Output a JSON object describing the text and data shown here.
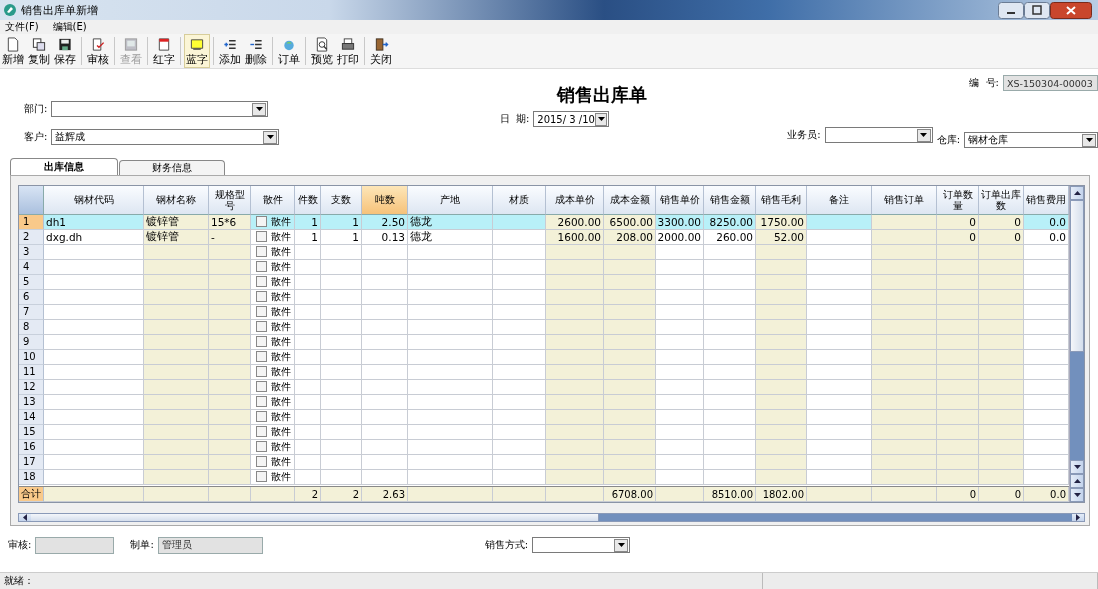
{
  "window": {
    "title": "销售出库单新增"
  },
  "menu": [
    {
      "label": "文件(F)"
    },
    {
      "label": "编辑(E)"
    }
  ],
  "toolbar": [
    [
      {
        "label": "新增",
        "disabled": false,
        "selected": false
      },
      {
        "label": "复制",
        "disabled": false,
        "selected": false
      },
      {
        "label": "保存",
        "disabled": false,
        "selected": false
      }
    ],
    [
      {
        "label": "审核",
        "disabled": false,
        "selected": false
      }
    ],
    [
      {
        "label": "查看",
        "disabled": true,
        "selected": false
      }
    ],
    [
      {
        "label": "红字",
        "disabled": false,
        "selected": false
      }
    ],
    [
      {
        "label": "蓝字",
        "disabled": false,
        "selected": true
      }
    ],
    [
      {
        "label": "添加",
        "disabled": false,
        "selected": false
      },
      {
        "label": "删除",
        "disabled": false,
        "selected": false
      }
    ],
    [
      {
        "label": "订单",
        "disabled": false,
        "selected": false
      }
    ],
    [
      {
        "label": "预览",
        "disabled": false,
        "selected": false
      },
      {
        "label": "打印",
        "disabled": false,
        "selected": false
      }
    ],
    [
      {
        "label": "关闭",
        "disabled": false,
        "selected": false
      }
    ]
  ],
  "form": {
    "title": "销售出库单",
    "number": {
      "label": "编  号:",
      "value": "XS-150304-00003"
    },
    "department": {
      "label": "部门:"
    },
    "customer": {
      "label": "客户:",
      "value": "益辉成"
    },
    "date": {
      "label": "日  期:",
      "value": "2015/ 3 /10"
    },
    "salesperson": {
      "label": "业务员:"
    },
    "warehouse": {
      "label": "仓库:",
      "value": "钢材仓库"
    }
  },
  "tabs": [
    {
      "label": "出库信息",
      "selected": true
    },
    {
      "label": "财务信息",
      "selected": false
    }
  ],
  "table": {
    "columns": [
      {
        "label": "钢材代码",
        "kind": "text",
        "shaded": false,
        "selected": false
      },
      {
        "label": "钢材名称",
        "kind": "text",
        "shaded": true,
        "selected": false
      },
      {
        "label": "规格型号",
        "kind": "text",
        "shaded": true,
        "selected": false
      },
      {
        "label": "散件",
        "kind": "checkbox",
        "shaded": false,
        "selected": false
      },
      {
        "label": "件数",
        "kind": "number",
        "shaded": false,
        "selected": false
      },
      {
        "label": "支数",
        "kind": "number",
        "shaded": false,
        "selected": false
      },
      {
        "label": "吨数",
        "kind": "number",
        "shaded": false,
        "selected": true
      },
      {
        "label": "产地",
        "kind": "text",
        "shaded": false,
        "selected": false
      },
      {
        "label": "材质",
        "kind": "text",
        "shaded": false,
        "selected": false
      },
      {
        "label": "成本单价",
        "kind": "number",
        "shaded": true,
        "selected": false
      },
      {
        "label": "成本金额",
        "kind": "number",
        "shaded": true,
        "selected": false
      },
      {
        "label": "销售单价",
        "kind": "number",
        "shaded": false,
        "selected": false
      },
      {
        "label": "销售金额",
        "kind": "number",
        "shaded": false,
        "selected": false
      },
      {
        "label": "销售毛利",
        "kind": "number",
        "shaded": true,
        "selected": false
      },
      {
        "label": "备注",
        "kind": "text",
        "shaded": false,
        "selected": false
      },
      {
        "label": "销售订单",
        "kind": "text",
        "shaded": true,
        "selected": false
      },
      {
        "label": "订单数量",
        "kind": "number",
        "shaded": true,
        "selected": false
      },
      {
        "label": "订单出库数",
        "kind": "number",
        "shaded": true,
        "selected": false
      },
      {
        "label": "销售费用",
        "kind": "number",
        "shaded": false,
        "selected": false
      }
    ],
    "rows": [
      {
        "number": "1",
        "selected": true,
        "cells": [
          "dh1",
          "镀锌管",
          "15*6",
          {
            "checked": false,
            "label": "散件"
          },
          "1",
          "1",
          "2.50",
          "德龙",
          null,
          "2600.00",
          "6500.00",
          "3300.00",
          "8250.00",
          "1750.00",
          null,
          null,
          "0",
          "0",
          "0.0"
        ]
      },
      {
        "number": "2",
        "selected": false,
        "cells": [
          "dxg.dh",
          "镀锌管",
          "-",
          {
            "checked": false,
            "label": "散件"
          },
          "1",
          "1",
          "0.13",
          "德龙",
          null,
          "1600.00",
          "208.00",
          "2000.00",
          "260.00",
          "52.00",
          null,
          null,
          "0",
          "0",
          "0.0"
        ]
      },
      {
        "number": "3",
        "selected": false,
        "cells": [
          null,
          null,
          null,
          {
            "checked": false,
            "label": "散件"
          },
          null,
          null,
          null,
          null,
          null,
          null,
          null,
          null,
          null,
          null,
          null,
          null,
          null,
          null,
          null
        ]
      },
      {
        "number": "4",
        "selected": false,
        "cells": [
          null,
          null,
          null,
          {
            "checked": false,
            "label": "散件"
          },
          null,
          null,
          null,
          null,
          null,
          null,
          null,
          null,
          null,
          null,
          null,
          null,
          null,
          null,
          null
        ]
      },
      {
        "number": "5",
        "selected": false,
        "cells": [
          null,
          null,
          null,
          {
            "checked": false,
            "label": "散件"
          },
          null,
          null,
          null,
          null,
          null,
          null,
          null,
          null,
          null,
          null,
          null,
          null,
          null,
          null,
          null
        ]
      },
      {
        "number": "6",
        "selected": false,
        "cells": [
          null,
          null,
          null,
          {
            "checked": false,
            "label": "散件"
          },
          null,
          null,
          null,
          null,
          null,
          null,
          null,
          null,
          null,
          null,
          null,
          null,
          null,
          null,
          null
        ]
      },
      {
        "number": "7",
        "selected": false,
        "cells": [
          null,
          null,
          null,
          {
            "checked": false,
            "label": "散件"
          },
          null,
          null,
          null,
          null,
          null,
          null,
          null,
          null,
          null,
          null,
          null,
          null,
          null,
          null,
          null
        ]
      },
      {
        "number": "8",
        "selected": false,
        "cells": [
          null,
          null,
          null,
          {
            "checked": false,
            "label": "散件"
          },
          null,
          null,
          null,
          null,
          null,
          null,
          null,
          null,
          null,
          null,
          null,
          null,
          null,
          null,
          null
        ]
      },
      {
        "number": "9",
        "selected": false,
        "cells": [
          null,
          null,
          null,
          {
            "checked": false,
            "label": "散件"
          },
          null,
          null,
          null,
          null,
          null,
          null,
          null,
          null,
          null,
          null,
          null,
          null,
          null,
          null,
          null
        ]
      },
      {
        "number": "10",
        "selected": false,
        "cells": [
          null,
          null,
          null,
          {
            "checked": false,
            "label": "散件"
          },
          null,
          null,
          null,
          null,
          null,
          null,
          null,
          null,
          null,
          null,
          null,
          null,
          null,
          null,
          null
        ]
      },
      {
        "number": "11",
        "selected": false,
        "cells": [
          null,
          null,
          null,
          {
            "checked": false,
            "label": "散件"
          },
          null,
          null,
          null,
          null,
          null,
          null,
          null,
          null,
          null,
          null,
          null,
          null,
          null,
          null,
          null
        ]
      },
      {
        "number": "12",
        "selected": false,
        "cells": [
          null,
          null,
          null,
          {
            "checked": false,
            "label": "散件"
          },
          null,
          null,
          null,
          null,
          null,
          null,
          null,
          null,
          null,
          null,
          null,
          null,
          null,
          null,
          null
        ]
      },
      {
        "number": "13",
        "selected": false,
        "cells": [
          null,
          null,
          null,
          {
            "checked": false,
            "label": "散件"
          },
          null,
          null,
          null,
          null,
          null,
          null,
          null,
          null,
          null,
          null,
          null,
          null,
          null,
          null,
          null
        ]
      },
      {
        "number": "14",
        "selected": false,
        "cells": [
          null,
          null,
          null,
          {
            "checked": false,
            "label": "散件"
          },
          null,
          null,
          null,
          null,
          null,
          null,
          null,
          null,
          null,
          null,
          null,
          null,
          null,
          null,
          null
        ]
      },
      {
        "number": "15",
        "selected": false,
        "cells": [
          null,
          null,
          null,
          {
            "checked": false,
            "label": "散件"
          },
          null,
          null,
          null,
          null,
          null,
          null,
          null,
          null,
          null,
          null,
          null,
          null,
          null,
          null,
          null
        ]
      },
      {
        "number": "16",
        "selected": false,
        "cells": [
          null,
          null,
          null,
          {
            "checked": false,
            "label": "散件"
          },
          null,
          null,
          null,
          null,
          null,
          null,
          null,
          null,
          null,
          null,
          null,
          null,
          null,
          null,
          null
        ]
      },
      {
        "number": "17",
        "selected": false,
        "cells": [
          null,
          null,
          null,
          {
            "checked": false,
            "label": "散件"
          },
          null,
          null,
          null,
          null,
          null,
          null,
          null,
          null,
          null,
          null,
          null,
          null,
          null,
          null,
          null
        ]
      },
      {
        "number": "18",
        "selected": false,
        "cells": [
          null,
          null,
          null,
          {
            "checked": false,
            "label": "散件"
          },
          null,
          null,
          null,
          null,
          null,
          null,
          null,
          null,
          null,
          null,
          null,
          null,
          null,
          null,
          null
        ]
      }
    ],
    "totals": {
      "label": "合计",
      "cells": [
        null,
        null,
        null,
        null,
        "2",
        "2",
        "2.63",
        null,
        null,
        null,
        "6708.00",
        null,
        "8510.00",
        "1802.00",
        null,
        null,
        "0",
        "0",
        "0.0"
      ]
    }
  },
  "footer": {
    "reviewer": {
      "label": "审核:"
    },
    "creator": {
      "label": "制单:",
      "value": "管理员"
    },
    "sales_method": {
      "label": "销售方式:"
    }
  },
  "status_bar": {
    "text": "就绪："
  }
}
